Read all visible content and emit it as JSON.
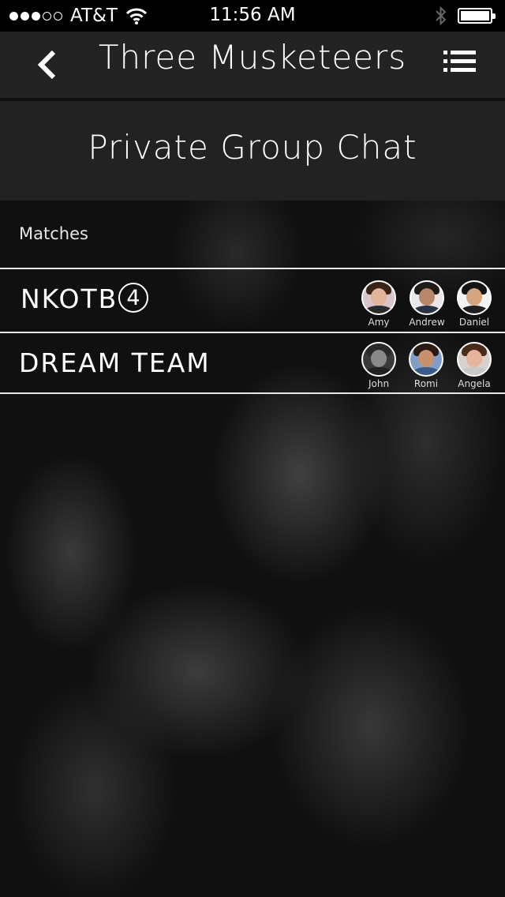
{
  "status_bar": {
    "carrier": "AT&T",
    "time": "11:56 AM",
    "signal_bars_filled": 3,
    "signal_bars_total": 5,
    "icons": [
      "wifi-icon",
      "bluetooth-icon",
      "battery-icon"
    ]
  },
  "navbar": {
    "title": "Three Musketeers",
    "back_icon": "chevron-left-icon",
    "menu_icon": "list-icon"
  },
  "header": {
    "title": "Private Group Chat"
  },
  "section": {
    "label": "Matches"
  },
  "groups": [
    {
      "name": "NKOTB",
      "badge": "4",
      "members": [
        {
          "name": "Amy",
          "hair": "#3a2418",
          "skin": "#e2b59a",
          "bg": "#d9c4c9",
          "shirt": "#2b2b2b"
        },
        {
          "name": "Andrew",
          "hair": "#1f1a16",
          "skin": "#b8876a",
          "bg": "#e8e8e8",
          "shirt": "#2a3442"
        },
        {
          "name": "Daniel",
          "hair": "#141414",
          "skin": "#d4a581",
          "bg": "#f2f2f2",
          "shirt": "#1f1f1f"
        }
      ]
    },
    {
      "name": "DREAM TEAM",
      "badge": "",
      "members": [
        {
          "name": "John",
          "hair": "#2a2a2a",
          "skin": "#8a8a8a",
          "bg": "#3a3a3a",
          "shirt": "#202020"
        },
        {
          "name": "Romi",
          "hair": "#2a1a12",
          "skin": "#c9906f",
          "bg": "#7f9fc8",
          "shirt": "#3b5d8a"
        },
        {
          "name": "Angela",
          "hair": "#4a2a18",
          "skin": "#e6b39c",
          "bg": "#d8d0cc",
          "shirt": "#c8c8c8"
        }
      ]
    }
  ],
  "colors": {
    "background": "#0a0a0a",
    "navbar": "#232323",
    "header": "#222222",
    "text": "#ffffff",
    "divider": "#e8e8e8"
  }
}
